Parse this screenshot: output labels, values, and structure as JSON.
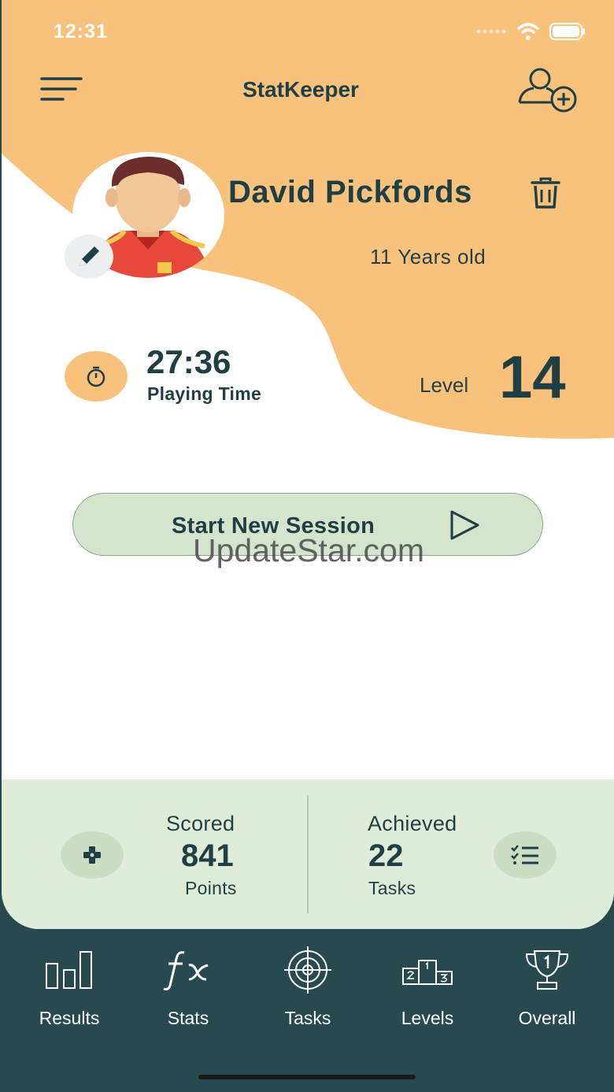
{
  "status_bar": {
    "time": "12:31"
  },
  "header": {
    "title": "StatKeeper",
    "menu_icon": "hamburger-menu-icon",
    "add_icon": "add-user-icon"
  },
  "profile": {
    "name": "David Pickfords",
    "age": "11 Years old",
    "playing_time": "27:36",
    "playing_time_label": "Playing Time",
    "level_label": "Level",
    "level": "14"
  },
  "session": {
    "label": "Start New Session"
  },
  "watermark": "UpdateStar.com",
  "stats": {
    "scored": {
      "heading": "Scored",
      "value": "841",
      "unit": "Points"
    },
    "achieved": {
      "heading": "Achieved",
      "value": "22",
      "unit": "Tasks"
    }
  },
  "tabs": [
    {
      "label": "Results",
      "icon": "bar-chart-icon"
    },
    {
      "label": "Stats",
      "icon": "function-icon"
    },
    {
      "label": "Tasks",
      "icon": "target-icon"
    },
    {
      "label": "Levels",
      "icon": "podium-icon"
    },
    {
      "label": "Overall",
      "icon": "trophy-icon"
    }
  ],
  "colors": {
    "accent": "#f8c27d",
    "dark": "#27494f",
    "text": "#1f3f44",
    "session_bg": "#d3e5cd",
    "stats_bg": "#deecd9"
  }
}
